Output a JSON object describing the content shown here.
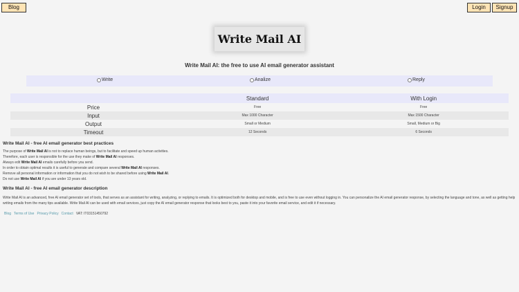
{
  "header": {
    "blog_label": "Blog",
    "login_label": "Login",
    "signup_label": "Signup"
  },
  "logo": {
    "text": "Write Mail AI"
  },
  "subtitle": "Write Mail AI: the free to use AI email generator assistant",
  "modes": [
    {
      "label": "Write"
    },
    {
      "label": "Analize"
    },
    {
      "label": "Reply"
    }
  ],
  "plans_table": {
    "columns": [
      "Standard",
      "With Login"
    ],
    "rows": [
      {
        "label": "Price",
        "standard": "Free",
        "login": "Free"
      },
      {
        "label": "Input",
        "standard": "Max 1000 Character",
        "login": "Max 1500 Character"
      },
      {
        "label": "Output",
        "standard": "Small or Medium",
        "login": "Small, Medium or Big"
      },
      {
        "label": "Timeout",
        "standard": "12 Seconds",
        "login": "6 Seconds"
      }
    ]
  },
  "best_practices": {
    "title": "Write Mail AI - free AI email generator best practices",
    "lines": [
      {
        "pre": "The purpose of ",
        "bold": "Write Mail AI",
        "post": " is not to replace human beings, but to facilitate and speed up human activities."
      },
      {
        "pre": "Therefore, each user is responsible for the use they make of ",
        "bold": "Write Mail AI",
        "post": " responses."
      },
      {
        "pre": "Always edit ",
        "bold": "Write Mail AI",
        "post": " emails carefully before you send."
      },
      {
        "pre": "In order to obtain optimal results it is useful to generate and compare several ",
        "bold": "Write Mail AI",
        "post": " responses."
      },
      {
        "pre": "Remove all personal information or information that you do not wish to be shared before using ",
        "bold": "Write Mail AI",
        "post": "."
      },
      {
        "pre": "Do not use ",
        "bold": "Write Mail AI",
        "post": " if you are under 13 years old."
      }
    ]
  },
  "description": {
    "title": "Write Mail AI - free AI email generator description",
    "text": "Write Mail AI is an advanced, free AI email generator set of tools, that serves as an assistant for writing, analyzing, or replying to emails. It is optimized both for desktop and mobile, and is free to use even without logging in. You can personalize the AI email generator response, by selecting the language and tone, as well as getting help writing emails from the many tips available. Write Mail AI can be used with email services, just copy the AI email generator response that looks best to you, paste it into your favorite email service, and edit it if necessary."
  },
  "footer": {
    "links": [
      "Blog",
      "Terms of Use",
      "Privacy Policy",
      "Contact"
    ],
    "vat": "VAT: IT03151450792"
  },
  "colors": {
    "button_bg": "#ffe4b5",
    "band_bg": "#e8e8fa",
    "page_bg": "#f4f4f4",
    "link": "#5599aa"
  }
}
